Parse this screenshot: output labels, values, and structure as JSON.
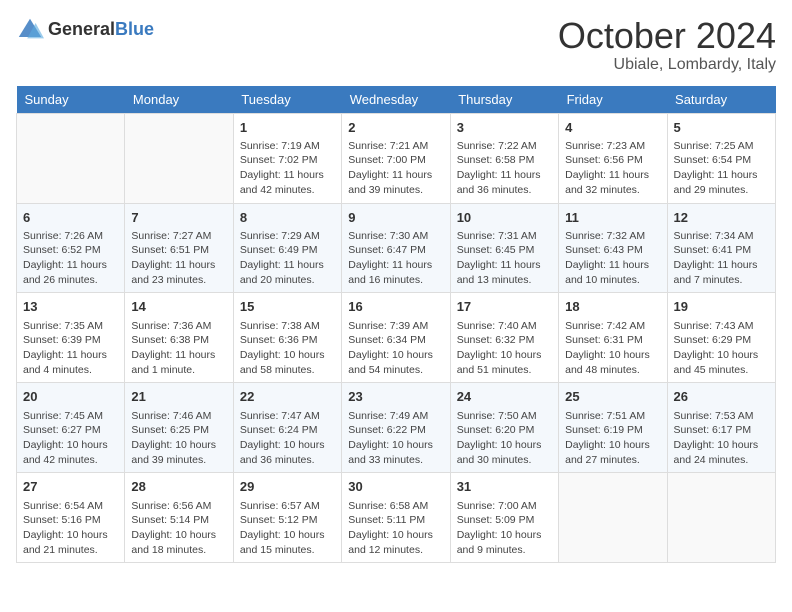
{
  "header": {
    "logo_general": "General",
    "logo_blue": "Blue",
    "month_title": "October 2024",
    "location": "Ubiale, Lombardy, Italy"
  },
  "days_of_week": [
    "Sunday",
    "Monday",
    "Tuesday",
    "Wednesday",
    "Thursday",
    "Friday",
    "Saturday"
  ],
  "weeks": [
    [
      {
        "day": "",
        "sunrise": "",
        "sunset": "",
        "daylight": ""
      },
      {
        "day": "",
        "sunrise": "",
        "sunset": "",
        "daylight": ""
      },
      {
        "day": "1",
        "sunrise": "Sunrise: 7:19 AM",
        "sunset": "Sunset: 7:02 PM",
        "daylight": "Daylight: 11 hours and 42 minutes."
      },
      {
        "day": "2",
        "sunrise": "Sunrise: 7:21 AM",
        "sunset": "Sunset: 7:00 PM",
        "daylight": "Daylight: 11 hours and 39 minutes."
      },
      {
        "day": "3",
        "sunrise": "Sunrise: 7:22 AM",
        "sunset": "Sunset: 6:58 PM",
        "daylight": "Daylight: 11 hours and 36 minutes."
      },
      {
        "day": "4",
        "sunrise": "Sunrise: 7:23 AM",
        "sunset": "Sunset: 6:56 PM",
        "daylight": "Daylight: 11 hours and 32 minutes."
      },
      {
        "day": "5",
        "sunrise": "Sunrise: 7:25 AM",
        "sunset": "Sunset: 6:54 PM",
        "daylight": "Daylight: 11 hours and 29 minutes."
      }
    ],
    [
      {
        "day": "6",
        "sunrise": "Sunrise: 7:26 AM",
        "sunset": "Sunset: 6:52 PM",
        "daylight": "Daylight: 11 hours and 26 minutes."
      },
      {
        "day": "7",
        "sunrise": "Sunrise: 7:27 AM",
        "sunset": "Sunset: 6:51 PM",
        "daylight": "Daylight: 11 hours and 23 minutes."
      },
      {
        "day": "8",
        "sunrise": "Sunrise: 7:29 AM",
        "sunset": "Sunset: 6:49 PM",
        "daylight": "Daylight: 11 hours and 20 minutes."
      },
      {
        "day": "9",
        "sunrise": "Sunrise: 7:30 AM",
        "sunset": "Sunset: 6:47 PM",
        "daylight": "Daylight: 11 hours and 16 minutes."
      },
      {
        "day": "10",
        "sunrise": "Sunrise: 7:31 AM",
        "sunset": "Sunset: 6:45 PM",
        "daylight": "Daylight: 11 hours and 13 minutes."
      },
      {
        "day": "11",
        "sunrise": "Sunrise: 7:32 AM",
        "sunset": "Sunset: 6:43 PM",
        "daylight": "Daylight: 11 hours and 10 minutes."
      },
      {
        "day": "12",
        "sunrise": "Sunrise: 7:34 AM",
        "sunset": "Sunset: 6:41 PM",
        "daylight": "Daylight: 11 hours and 7 minutes."
      }
    ],
    [
      {
        "day": "13",
        "sunrise": "Sunrise: 7:35 AM",
        "sunset": "Sunset: 6:39 PM",
        "daylight": "Daylight: 11 hours and 4 minutes."
      },
      {
        "day": "14",
        "sunrise": "Sunrise: 7:36 AM",
        "sunset": "Sunset: 6:38 PM",
        "daylight": "Daylight: 11 hours and 1 minute."
      },
      {
        "day": "15",
        "sunrise": "Sunrise: 7:38 AM",
        "sunset": "Sunset: 6:36 PM",
        "daylight": "Daylight: 10 hours and 58 minutes."
      },
      {
        "day": "16",
        "sunrise": "Sunrise: 7:39 AM",
        "sunset": "Sunset: 6:34 PM",
        "daylight": "Daylight: 10 hours and 54 minutes."
      },
      {
        "day": "17",
        "sunrise": "Sunrise: 7:40 AM",
        "sunset": "Sunset: 6:32 PM",
        "daylight": "Daylight: 10 hours and 51 minutes."
      },
      {
        "day": "18",
        "sunrise": "Sunrise: 7:42 AM",
        "sunset": "Sunset: 6:31 PM",
        "daylight": "Daylight: 10 hours and 48 minutes."
      },
      {
        "day": "19",
        "sunrise": "Sunrise: 7:43 AM",
        "sunset": "Sunset: 6:29 PM",
        "daylight": "Daylight: 10 hours and 45 minutes."
      }
    ],
    [
      {
        "day": "20",
        "sunrise": "Sunrise: 7:45 AM",
        "sunset": "Sunset: 6:27 PM",
        "daylight": "Daylight: 10 hours and 42 minutes."
      },
      {
        "day": "21",
        "sunrise": "Sunrise: 7:46 AM",
        "sunset": "Sunset: 6:25 PM",
        "daylight": "Daylight: 10 hours and 39 minutes."
      },
      {
        "day": "22",
        "sunrise": "Sunrise: 7:47 AM",
        "sunset": "Sunset: 6:24 PM",
        "daylight": "Daylight: 10 hours and 36 minutes."
      },
      {
        "day": "23",
        "sunrise": "Sunrise: 7:49 AM",
        "sunset": "Sunset: 6:22 PM",
        "daylight": "Daylight: 10 hours and 33 minutes."
      },
      {
        "day": "24",
        "sunrise": "Sunrise: 7:50 AM",
        "sunset": "Sunset: 6:20 PM",
        "daylight": "Daylight: 10 hours and 30 minutes."
      },
      {
        "day": "25",
        "sunrise": "Sunrise: 7:51 AM",
        "sunset": "Sunset: 6:19 PM",
        "daylight": "Daylight: 10 hours and 27 minutes."
      },
      {
        "day": "26",
        "sunrise": "Sunrise: 7:53 AM",
        "sunset": "Sunset: 6:17 PM",
        "daylight": "Daylight: 10 hours and 24 minutes."
      }
    ],
    [
      {
        "day": "27",
        "sunrise": "Sunrise: 6:54 AM",
        "sunset": "Sunset: 5:16 PM",
        "daylight": "Daylight: 10 hours and 21 minutes."
      },
      {
        "day": "28",
        "sunrise": "Sunrise: 6:56 AM",
        "sunset": "Sunset: 5:14 PM",
        "daylight": "Daylight: 10 hours and 18 minutes."
      },
      {
        "day": "29",
        "sunrise": "Sunrise: 6:57 AM",
        "sunset": "Sunset: 5:12 PM",
        "daylight": "Daylight: 10 hours and 15 minutes."
      },
      {
        "day": "30",
        "sunrise": "Sunrise: 6:58 AM",
        "sunset": "Sunset: 5:11 PM",
        "daylight": "Daylight: 10 hours and 12 minutes."
      },
      {
        "day": "31",
        "sunrise": "Sunrise: 7:00 AM",
        "sunset": "Sunset: 5:09 PM",
        "daylight": "Daylight: 10 hours and 9 minutes."
      },
      {
        "day": "",
        "sunrise": "",
        "sunset": "",
        "daylight": ""
      },
      {
        "day": "",
        "sunrise": "",
        "sunset": "",
        "daylight": ""
      }
    ]
  ]
}
